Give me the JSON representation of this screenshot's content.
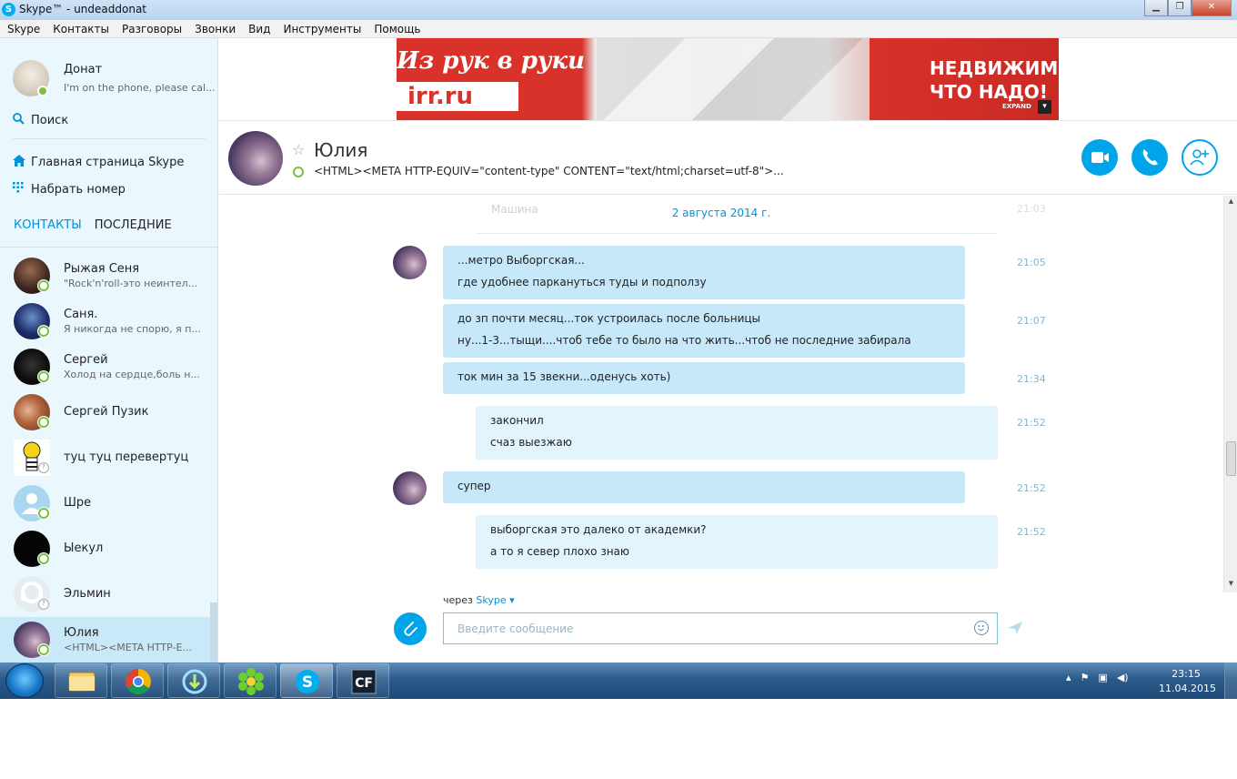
{
  "window": {
    "title": "Skype™ - undeaddonat",
    "minimize": "▁",
    "maximize": "❐",
    "close": "✕"
  },
  "menu": [
    "Skype",
    "Контакты",
    "Разговоры",
    "Звонки",
    "Вид",
    "Инструменты",
    "Помощь"
  ],
  "profile": {
    "name": "Донат",
    "mood": "I'm on the phone, please cal..."
  },
  "sidebar": {
    "search": "Поиск",
    "home": "Главная страница Skype",
    "dial": "Набрать номер",
    "tab_contacts": "КОНТАКТЫ",
    "tab_recent": "ПОСЛЕДНИЕ"
  },
  "contacts": [
    {
      "name": "Рыжая Сеня",
      "mood": "\"Rock'n'roll-это неинтел..."
    },
    {
      "name": "Саня.",
      "mood": "Я никогда не спорю, я п..."
    },
    {
      "name": "Сергей",
      "mood": "Холод на сердце,боль н..."
    },
    {
      "name": "Сергей Пузик",
      "mood": ""
    },
    {
      "name": "туц туц перевертуц",
      "mood": ""
    },
    {
      "name": "Шре",
      "mood": ""
    },
    {
      "name": "Ыекул",
      "mood": ""
    },
    {
      "name": "Эльмин",
      "mood": ""
    },
    {
      "name": "Юлия",
      "mood": "<HTML><META HTTP-E..."
    }
  ],
  "banner": {
    "line1": "Из рук в руки",
    "line2": "irr.ru",
    "line3": "НЕДВИЖИМО",
    "line4": "ЧТО НАДО!",
    "expand": "EXPAND"
  },
  "chat": {
    "name": "Юлия",
    "mood": "<HTML><META HTTP-EQUIV=\"content-type\" CONTENT=\"text/html;charset=utf-8\">...",
    "date": "2 августа 2014 г.",
    "ghost_name": "Машина",
    "ghost_time": "21:03"
  },
  "messages": [
    {
      "lines": [
        "...метро Выборгская...",
        "где удобнее паркануться туды и подползу"
      ],
      "time": "21:05",
      "mine": false
    },
    {
      "lines": [
        "до зп почти месяц...ток устроилась после больницы",
        "ну...1-3...тыщи....чтоб тебе то было на что жить...чтоб не последние забирала"
      ],
      "time": "21:07",
      "mine": false
    },
    {
      "lines": [
        "ток мин за 15 звекни...оденусь хоть)"
      ],
      "time": "21:34",
      "mine": false
    },
    {
      "lines": [
        "закончил",
        "счаз выезжаю"
      ],
      "time": "21:52",
      "mine": true
    },
    {
      "lines": [
        "супер"
      ],
      "time": "21:52",
      "mine": false
    },
    {
      "lines": [
        "выборгская это далеко от академки?",
        "а то я север плохо знаю"
      ],
      "time": "21:52",
      "mine": true
    }
  ],
  "composer": {
    "via_prefix": "через",
    "via_service": "Skype ▾",
    "placeholder": "Введите сообщение"
  },
  "taskbar": {
    "time": "23:15",
    "date": "11.04.2015",
    "apps": [
      "explorer",
      "chrome",
      "download-manager",
      "icq",
      "skype",
      "crossfire"
    ]
  },
  "colors": {
    "accent": "#00a4e9",
    "incoming_bubble": "#c7e8f8",
    "outgoing_bubble": "#e3f4fc",
    "online": "#7ac143"
  }
}
